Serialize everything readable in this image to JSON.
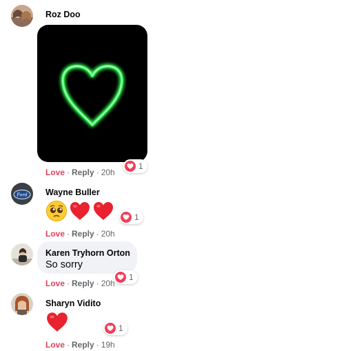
{
  "colors": {
    "love": "#e4405f",
    "meta": "#65676b",
    "bubble": "#f0f2f5",
    "reaction_heart": "#f33e58",
    "neon_heart": "#39ff5a"
  },
  "comments": [
    {
      "author": "Roz Doo",
      "avatar_icon": "profile-photo",
      "attachment": "green-neon-heart-image",
      "action_love": "Love",
      "action_reply": "Reply",
      "separator": "·",
      "time": "20h",
      "reaction_icon": "heart-reaction-icon",
      "reaction_count": "1"
    },
    {
      "author": "Wayne Buller",
      "avatar_icon": "ford-logo",
      "emojis": [
        "pleading-face",
        "red-heart",
        "red-heart"
      ],
      "action_love": "Love",
      "action_reply": "Reply",
      "separator": "·",
      "time": "20h",
      "reaction_icon": "heart-reaction-icon",
      "reaction_count": "1"
    },
    {
      "author": "Karen Tryhorn Orton",
      "avatar_icon": "profile-photo",
      "text": "So sorry",
      "action_love": "Love",
      "action_reply": "Reply",
      "separator": "·",
      "time": "20h",
      "reaction_icon": "heart-reaction-icon",
      "reaction_count": "1"
    },
    {
      "author": "Sharyn Vidito",
      "avatar_icon": "profile-photo",
      "emojis": [
        "red-heart"
      ],
      "action_love": "Love",
      "action_reply": "Reply",
      "separator": "·",
      "time": "19h",
      "reaction_icon": "heart-reaction-icon",
      "reaction_count": "1"
    }
  ]
}
